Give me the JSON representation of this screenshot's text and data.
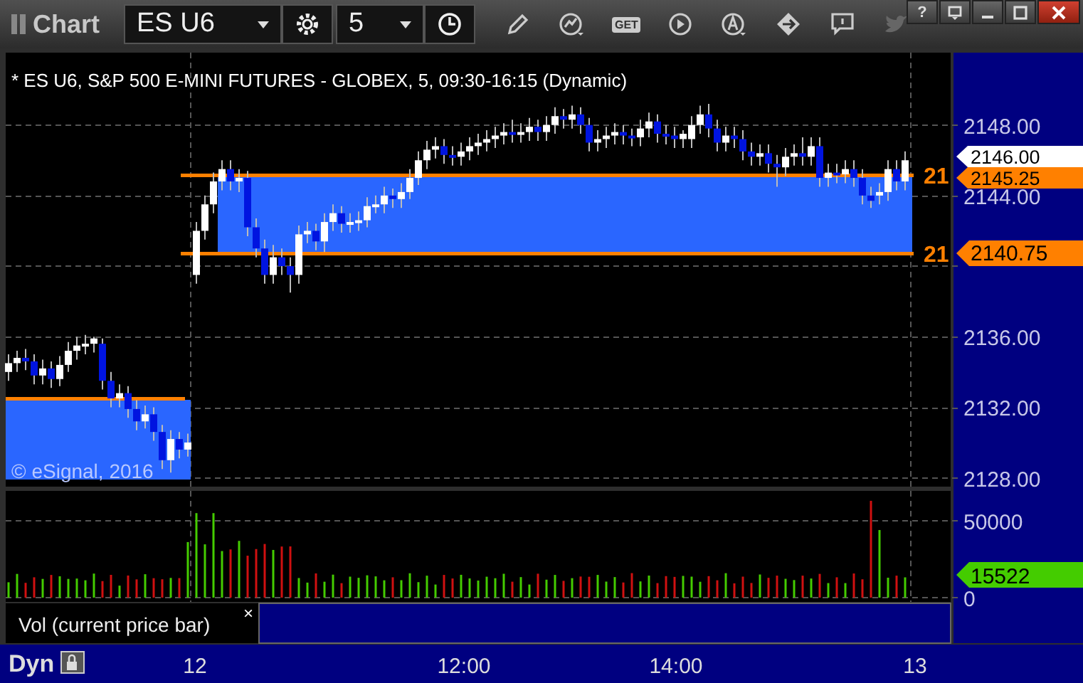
{
  "window_controls": {
    "help": "?"
  },
  "toolbar": {
    "title": "Chart",
    "symbol": "ES U6",
    "interval": "5",
    "get_label": "GET"
  },
  "chart": {
    "heading": "* ES U6, S&P 500 E-MINI FUTURES - GLOBEX, 5, 09:30-16:15 (Dynamic)",
    "watermark": "© eSignal, 2016",
    "chart_data": {
      "type": "candlestick",
      "categories": [
        null,
        null,
        null,
        null,
        null,
        null,
        null,
        null,
        null,
        null,
        null,
        null,
        null,
        null,
        null,
        null,
        null,
        null,
        null,
        null,
        null,
        null,
        null,
        null,
        null,
        null,
        null,
        null,
        null,
        null,
        null,
        null,
        null,
        null,
        null,
        null,
        null,
        null,
        null,
        null,
        null,
        null,
        null,
        null,
        null,
        null,
        null,
        null,
        null,
        null,
        null,
        null,
        null,
        null,
        null,
        null,
        null,
        null,
        null,
        null,
        null,
        null,
        null,
        null,
        null,
        null,
        null,
        null,
        null,
        null,
        null,
        null,
        null,
        null,
        null,
        null,
        null,
        null,
        null,
        null,
        null,
        null,
        null,
        null,
        null,
        null,
        null,
        null,
        null,
        null,
        null,
        null,
        null,
        null,
        null,
        null,
        null,
        null,
        null,
        null,
        null,
        null,
        null,
        null,
        null,
        null
      ],
      "ohlc": [
        [
          2134.0,
          2135.0,
          2133.5,
          2134.5
        ],
        [
          2134.5,
          2135.2,
          2134.0,
          2134.8
        ],
        [
          2134.8,
          2135.3,
          2134.1,
          2134.6
        ],
        [
          2134.6,
          2135.0,
          2133.3,
          2133.8
        ],
        [
          2133.8,
          2134.7,
          2133.3,
          2134.2
        ],
        [
          2134.2,
          2134.6,
          2133.1,
          2133.6
        ],
        [
          2133.6,
          2134.9,
          2133.2,
          2134.4
        ],
        [
          2134.4,
          2135.7,
          2134.0,
          2135.2
        ],
        [
          2135.2,
          2136.0,
          2134.7,
          2135.5
        ],
        [
          2135.5,
          2136.1,
          2135.0,
          2135.6
        ],
        [
          2135.6,
          2136.0,
          2135.1,
          2135.9
        ],
        [
          2135.6,
          2135.9,
          2133.0,
          2133.5
        ],
        [
          2133.5,
          2134.0,
          2132.0,
          2132.5
        ],
        [
          2132.5,
          2133.3,
          2132.0,
          2132.8
        ],
        [
          2132.8,
          2133.2,
          2131.4,
          2131.9
        ],
        [
          2131.9,
          2132.4,
          2130.7,
          2131.2
        ],
        [
          2131.2,
          2132.1,
          2130.8,
          2131.6
        ],
        [
          2131.6,
          2132.0,
          2130.1,
          2130.6
        ],
        [
          2130.6,
          2131.0,
          2128.5,
          2129.0
        ],
        [
          2129.0,
          2130.7,
          2128.3,
          2130.2
        ],
        [
          2130.2,
          2130.6,
          2129.1,
          2129.6
        ],
        [
          2129.6,
          2130.5,
          2129.2,
          2130.0
        ],
        [
          2139.5,
          2142.5,
          2139.0,
          2142.0
        ],
        [
          2142.0,
          2144.0,
          2141.5,
          2143.5
        ],
        [
          2143.5,
          2145.3,
          2143.0,
          2144.8
        ],
        [
          2144.8,
          2146.0,
          2144.3,
          2145.5
        ],
        [
          2145.5,
          2146.0,
          2144.3,
          2144.8
        ],
        [
          2144.8,
          2145.5,
          2144.2,
          2145.0
        ],
        [
          2145.0,
          2145.4,
          2141.7,
          2142.2
        ],
        [
          2142.2,
          2142.7,
          2140.5,
          2141.0
        ],
        [
          2141.0,
          2141.5,
          2139.0,
          2139.5
        ],
        [
          2139.5,
          2141.2,
          2139.0,
          2140.5
        ],
        [
          2140.5,
          2141.0,
          2139.5,
          2140.0
        ],
        [
          2140.0,
          2140.5,
          2138.5,
          2139.5
        ],
        [
          2139.5,
          2142.3,
          2139.0,
          2141.8
        ],
        [
          2141.8,
          2142.5,
          2141.3,
          2142.0
        ],
        [
          2142.0,
          2142.4,
          2140.9,
          2141.4
        ],
        [
          2141.4,
          2143.0,
          2140.8,
          2142.5
        ],
        [
          2142.5,
          2143.5,
          2142.0,
          2143.0
        ],
        [
          2143.0,
          2143.4,
          2141.9,
          2142.4
        ],
        [
          2142.4,
          2143.0,
          2141.9,
          2142.5
        ],
        [
          2142.5,
          2143.1,
          2142.0,
          2142.6
        ],
        [
          2142.6,
          2143.9,
          2142.2,
          2143.4
        ],
        [
          2143.4,
          2144.0,
          2143.0,
          2143.5
        ],
        [
          2143.5,
          2144.5,
          2143.0,
          2144.0
        ],
        [
          2144.0,
          2144.4,
          2143.3,
          2143.8
        ],
        [
          2143.8,
          2144.7,
          2143.3,
          2144.2
        ],
        [
          2144.2,
          2145.5,
          2143.8,
          2145.0
        ],
        [
          2145.0,
          2146.5,
          2144.6,
          2146.0
        ],
        [
          2146.0,
          2147.1,
          2145.5,
          2146.6
        ],
        [
          2146.6,
          2147.3,
          2146.1,
          2146.8
        ],
        [
          2146.8,
          2147.2,
          2145.8,
          2146.3
        ],
        [
          2146.3,
          2146.8,
          2145.7,
          2146.2
        ],
        [
          2146.2,
          2147.0,
          2145.7,
          2146.5
        ],
        [
          2146.5,
          2147.3,
          2146.0,
          2146.8
        ],
        [
          2146.8,
          2147.5,
          2146.3,
          2147.0
        ],
        [
          2147.0,
          2147.7,
          2146.5,
          2147.2
        ],
        [
          2147.2,
          2147.9,
          2146.7,
          2147.4
        ],
        [
          2147.4,
          2148.1,
          2146.9,
          2147.6
        ],
        [
          2147.6,
          2148.3,
          2147.0,
          2147.5
        ],
        [
          2147.5,
          2148.1,
          2147.0,
          2147.6
        ],
        [
          2147.6,
          2148.4,
          2147.1,
          2147.9
        ],
        [
          2147.9,
          2148.3,
          2147.1,
          2147.6
        ],
        [
          2147.6,
          2148.5,
          2147.1,
          2148.0
        ],
        [
          2148.0,
          2149.0,
          2147.5,
          2148.5
        ],
        [
          2148.5,
          2148.9,
          2147.8,
          2148.3
        ],
        [
          2148.3,
          2149.1,
          2147.8,
          2148.6
        ],
        [
          2148.6,
          2149.0,
          2147.5,
          2148.0
        ],
        [
          2148.0,
          2148.4,
          2146.5,
          2147.0
        ],
        [
          2147.0,
          2147.7,
          2146.5,
          2147.2
        ],
        [
          2147.2,
          2147.9,
          2146.7,
          2147.4
        ],
        [
          2147.4,
          2148.1,
          2146.9,
          2147.6
        ],
        [
          2147.6,
          2148.0,
          2146.9,
          2147.4
        ],
        [
          2147.4,
          2147.8,
          2146.8,
          2147.3
        ],
        [
          2147.3,
          2148.3,
          2146.8,
          2147.8
        ],
        [
          2147.8,
          2148.7,
          2147.3,
          2148.2
        ],
        [
          2148.2,
          2148.6,
          2147.0,
          2147.5
        ],
        [
          2147.5,
          2148.0,
          2146.9,
          2147.4
        ],
        [
          2147.4,
          2147.9,
          2146.7,
          2147.2
        ],
        [
          2147.2,
          2147.7,
          2146.7,
          2147.5
        ],
        [
          2147.2,
          2148.5,
          2146.7,
          2148.0
        ],
        [
          2148.0,
          2149.1,
          2147.5,
          2148.6
        ],
        [
          2148.6,
          2149.2,
          2147.3,
          2147.8
        ],
        [
          2147.8,
          2148.3,
          2146.5,
          2147.0
        ],
        [
          2147.0,
          2147.9,
          2146.5,
          2147.4
        ],
        [
          2147.4,
          2147.9,
          2146.7,
          2147.2
        ],
        [
          2147.2,
          2147.7,
          2146.0,
          2146.5
        ],
        [
          2146.5,
          2147.0,
          2145.7,
          2146.2
        ],
        [
          2146.2,
          2146.9,
          2145.7,
          2146.4
        ],
        [
          2146.4,
          2146.9,
          2145.3,
          2145.8
        ],
        [
          2145.8,
          2146.3,
          2144.5,
          2145.6
        ],
        [
          2145.6,
          2146.7,
          2145.1,
          2146.2
        ],
        [
          2146.2,
          2146.9,
          2145.7,
          2146.4
        ],
        [
          2146.4,
          2147.3,
          2145.7,
          2146.2
        ],
        [
          2146.2,
          2147.3,
          2145.7,
          2146.8
        ],
        [
          2146.8,
          2147.3,
          2144.5,
          2145.0
        ],
        [
          2145.0,
          2145.8,
          2144.5,
          2145.3
        ],
        [
          2145.3,
          2145.8,
          2144.7,
          2145.2
        ],
        [
          2145.2,
          2146.0,
          2144.7,
          2145.5
        ],
        [
          2145.5,
          2146.0,
          2144.5,
          2145.0
        ],
        [
          2145.0,
          2145.5,
          2143.5,
          2144.0
        ],
        [
          2144.0,
          2144.5,
          2143.3,
          2143.7
        ],
        [
          2144.0,
          2144.7,
          2143.5,
          2144.2
        ],
        [
          2144.2,
          2146.0,
          2143.7,
          2145.5
        ],
        [
          2145.5,
          2146.0,
          2144.3,
          2144.8
        ],
        [
          2144.8,
          2146.5,
          2144.3,
          2146.0
        ]
      ],
      "yticks": [
        {
          "value": 2148,
          "label": "2148.00"
        },
        {
          "value": 2144,
          "label": "2144.00"
        },
        {
          "value": 2136,
          "label": "2136.00"
        },
        {
          "value": 2132,
          "label": "2132.00"
        },
        {
          "value": 2128,
          "label": "2128.00"
        }
      ],
      "ylim": [
        2127.5,
        2152.1
      ],
      "orientation": "vertical"
    },
    "time_axis": [
      "12",
      "12:00",
      "14:00",
      "13"
    ],
    "level_labels": [
      "21",
      "21"
    ],
    "price_tags": [
      {
        "text": "2146.00",
        "color": "#ffffff"
      },
      {
        "text": "2145.25",
        "color": "#ff8000"
      },
      {
        "text": "2140.75",
        "color": "#ff8000"
      }
    ],
    "volume_axis": [
      "50000",
      "0"
    ],
    "volume_tag": {
      "text": "15522",
      "color": "#44cc00"
    },
    "study_label": "Vol (current price bar)",
    "study_close": "×",
    "mode": "Dyn"
  }
}
